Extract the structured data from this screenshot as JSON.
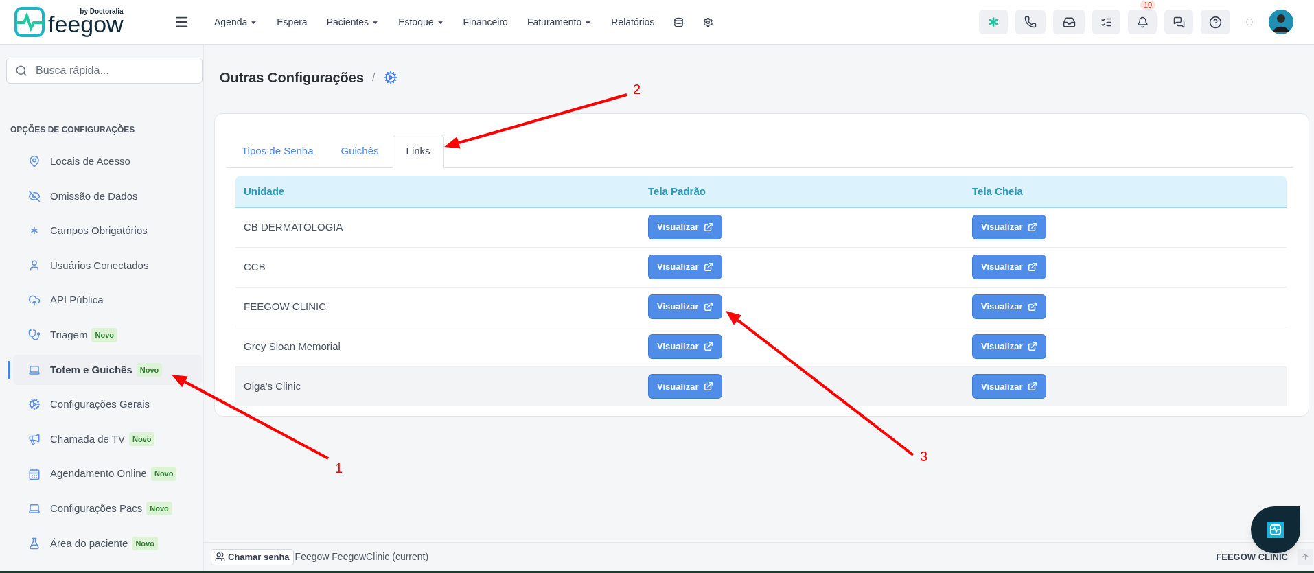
{
  "logo": {
    "name": "feegow",
    "tagline": "by Doctoralia"
  },
  "nav": [
    {
      "label": "Agenda",
      "dropdown": true
    },
    {
      "label": "Espera",
      "dropdown": false
    },
    {
      "label": "Pacientes",
      "dropdown": true
    },
    {
      "label": "Estoque",
      "dropdown": true
    },
    {
      "label": "Financeiro",
      "dropdown": false
    },
    {
      "label": "Faturamento",
      "dropdown": true
    },
    {
      "label": "Relatórios",
      "dropdown": false
    }
  ],
  "notifications": {
    "count": "10"
  },
  "search": {
    "placeholder": "Busca rápida..."
  },
  "sidebar": {
    "heading": "OPÇÕES DE CONFIGURAÇÕES",
    "items": [
      {
        "label": "Locais de Acesso",
        "selected": false
      },
      {
        "label": "Omissão de Dados",
        "selected": false
      },
      {
        "label": "Campos Obrigatórios",
        "selected": false
      },
      {
        "label": "Usuários Conectados",
        "selected": false
      },
      {
        "label": "API Pública",
        "selected": false
      },
      {
        "label": "Triagem",
        "badge": "Novo",
        "selected": false
      },
      {
        "label": "Totem e Guichês",
        "badge": "Novo",
        "selected": true
      },
      {
        "label": "Configurações Gerais",
        "selected": false
      },
      {
        "label": "Chamada de TV",
        "badge": "Novo",
        "selected": false
      },
      {
        "label": "Agendamento Online",
        "badge": "Novo",
        "selected": false
      },
      {
        "label": "Configurações Pacs",
        "badge": "Novo",
        "selected": false
      },
      {
        "label": "Área do paciente",
        "badge": "Novo",
        "selected": false
      }
    ]
  },
  "page": {
    "title": "Outras Configurações",
    "separator": "/"
  },
  "tabs": [
    {
      "label": "Tipos de Senha",
      "selected": false
    },
    {
      "label": "Guichês",
      "selected": false
    },
    {
      "label": "Links",
      "selected": true
    }
  ],
  "table": {
    "columns": [
      "Unidade",
      "Tela Padrão",
      "Tela Cheia"
    ],
    "rows": [
      {
        "unit": "CB DERMATOLOGIA",
        "buttons": [
          "Visualizar",
          "Visualizar"
        ],
        "hovered": false
      },
      {
        "unit": "CCB",
        "buttons": [
          "Visualizar",
          "Visualizar"
        ],
        "hovered": false
      },
      {
        "unit": "FEEGOW CLINIC",
        "buttons": [
          "Visualizar",
          "Visualizar"
        ],
        "hovered": false
      },
      {
        "unit": "Grey Sloan Memorial",
        "buttons": [
          "Visualizar",
          "Visualizar"
        ],
        "hovered": false
      },
      {
        "unit": "Olga's Clinic",
        "buttons": [
          "Visualizar",
          "Visualizar"
        ],
        "hovered": true
      }
    ]
  },
  "annotations": [
    "1",
    "2",
    "3"
  ],
  "footer": {
    "call_button": "Chamar senha",
    "session": "Feegow FeegowClinic (current)",
    "clinic": "FEEGOW CLINIC"
  }
}
